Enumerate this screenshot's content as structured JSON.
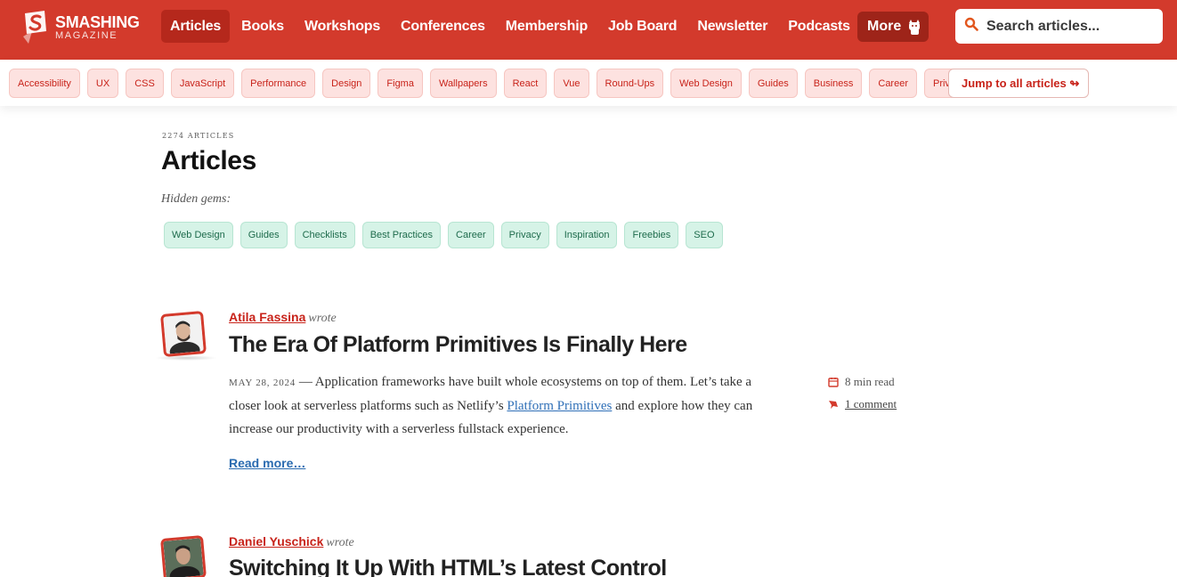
{
  "brand": {
    "line1": "SMASHING",
    "line2": "MAGAZINE",
    "accent": "#d33a2c"
  },
  "nav": {
    "items": [
      {
        "label": "Articles",
        "active": true
      },
      {
        "label": "Books"
      },
      {
        "label": "Workshops"
      },
      {
        "label": "Conferences"
      },
      {
        "label": "Membership"
      },
      {
        "label": "Job Board"
      },
      {
        "label": "Newsletter"
      },
      {
        "label": "Podcasts"
      }
    ],
    "more_label": "More",
    "more_icon": "cat-icon"
  },
  "search": {
    "placeholder": "Search articles...",
    "icon": "search-icon"
  },
  "tags": [
    "Accessibility",
    "UX",
    "CSS",
    "JavaScript",
    "Performance",
    "Design",
    "Figma",
    "Wallpapers",
    "React",
    "Vue",
    "Round-Ups",
    "Web Design",
    "Guides",
    "Business",
    "Career",
    "Privacy"
  ],
  "jump_label": "Jump to all articles ↬",
  "page": {
    "count": "2274 ARTICLES",
    "title": "Articles",
    "subtitle": "Hidden gems:",
    "gems": [
      "Web Design",
      "Guides",
      "Checklists",
      "Best Practices",
      "Career",
      "Privacy",
      "Inspiration",
      "Freebies",
      "SEO"
    ]
  },
  "articles": [
    {
      "author": "Atila Fassina",
      "wrote": "wrote",
      "title": "The Era Of Platform Primitives Is Finally Here",
      "date": "May 28, 2024",
      "dash": " — ",
      "excerpt_before": "Application frameworks have built whole ecosystems on top of them. Let’s take a closer look at serverless platforms such as Netlify’s ",
      "excerpt_link": "Platform Primitives",
      "excerpt_after": " and explore how they can increase our productivity with a serverless fullstack experience.",
      "read_more": "Read more…",
      "read_time": "8 min read",
      "comments": "1 comment"
    },
    {
      "author": "Daniel Yuschick",
      "wrote": "wrote",
      "title": "Switching It Up With HTML’s Latest Control"
    }
  ]
}
